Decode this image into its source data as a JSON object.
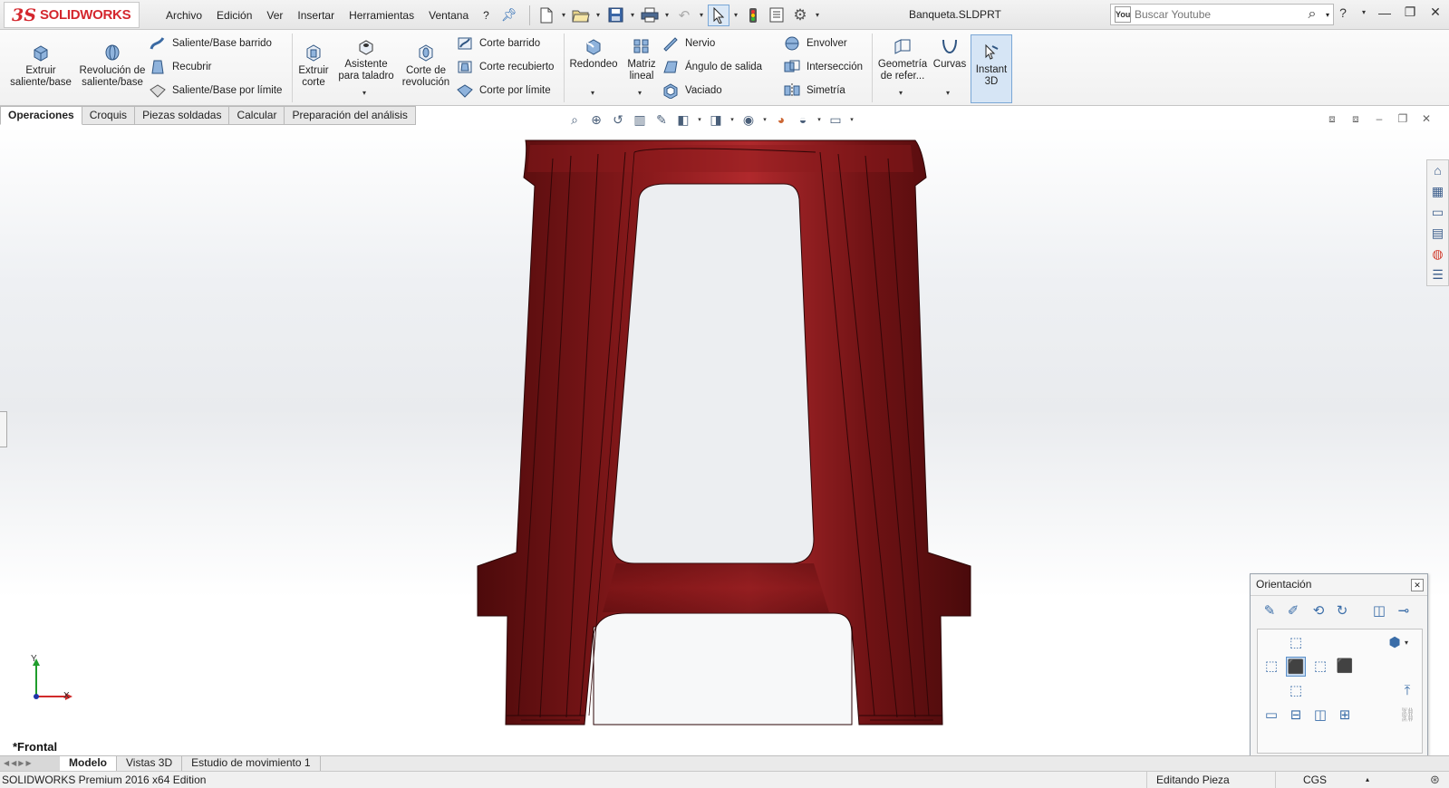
{
  "app": {
    "logo_mark": "3S",
    "logo_text": "SOLIDWORKS",
    "document_title": "Banqueta.SLDPRT"
  },
  "menu": {
    "items": [
      "Archivo",
      "Edición",
      "Ver",
      "Insertar",
      "Herramientas",
      "Ventana",
      "?"
    ]
  },
  "search": {
    "placeholder": "Buscar Youtube",
    "yt_label": "You"
  },
  "ribbon": {
    "extrude_boss": "Extruir saliente/base",
    "revolve_boss": "Revolución de saliente/base",
    "swept_boss": "Saliente/Base barrido",
    "loft_boss": "Recubrir",
    "boundary_boss": "Saliente/Base por límite",
    "extrude_cut": "Extruir corte",
    "hole_wizard": "Asistente para taladro",
    "revolve_cut": "Corte de revolución",
    "swept_cut": "Corte barrido",
    "loft_cut": "Corte recubierto",
    "boundary_cut": "Corte por límite",
    "fillet": "Redondeo",
    "linear_pattern": "Matriz lineal",
    "rib": "Nervio",
    "draft": "Ángulo de salida",
    "shell": "Vaciado",
    "wrap": "Envolver",
    "intersect": "Intersección",
    "mirror": "Simetría",
    "reference_geometry": "Geometría de refer...",
    "curves": "Curvas",
    "instant3d": "Instant 3D"
  },
  "command_tabs": [
    "Operaciones",
    "Croquis",
    "Piezas soldadas",
    "Calcular",
    "Preparación del análisis"
  ],
  "viewport": {
    "view_name": "*Frontal",
    "triad_y": "Y",
    "triad_x": "X",
    "model_color": "#7a1517"
  },
  "orientation_dialog": {
    "title": "Orientación"
  },
  "bottom_tabs": [
    "Modelo",
    "Vistas 3D",
    "Estudio de movimiento 1"
  ],
  "status": {
    "product": "SOLIDWORKS Premium 2016 x64 Edition",
    "mode": "Editando Pieza",
    "units": "CGS"
  }
}
